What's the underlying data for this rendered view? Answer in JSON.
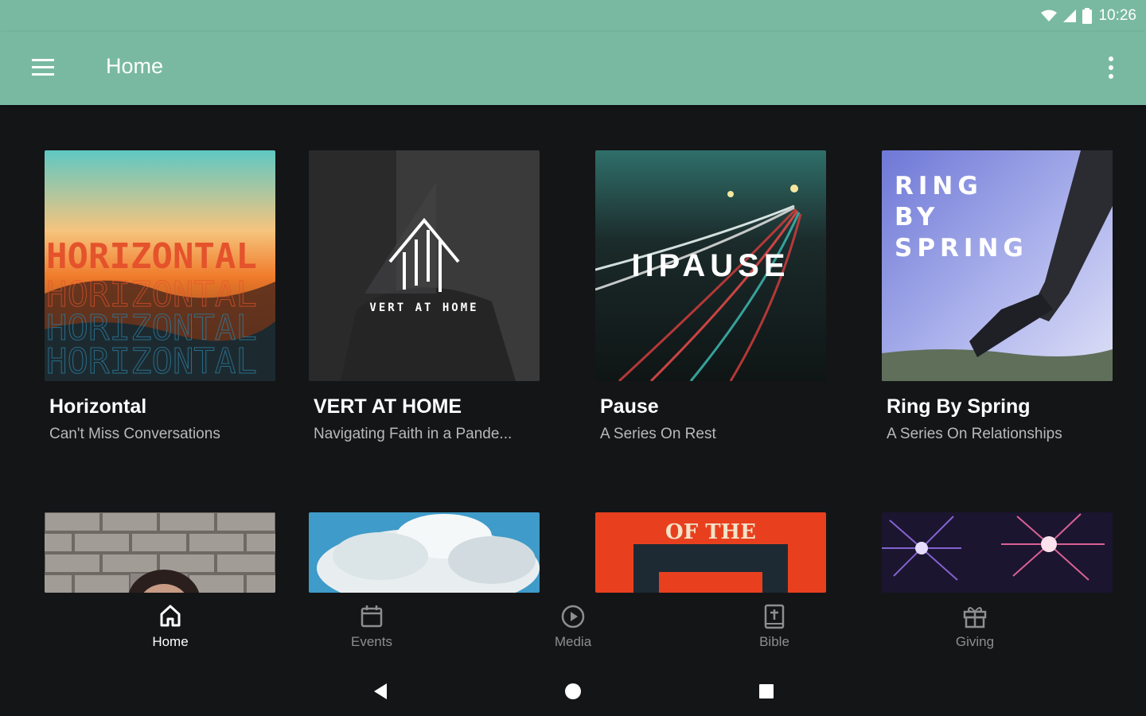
{
  "status_bar": {
    "time": "10:26"
  },
  "app_bar": {
    "title": "Home"
  },
  "cards": [
    {
      "title": "Horizontal",
      "subtitle": "Can't Miss Conversations",
      "art_text": "HORIZONTAL"
    },
    {
      "title": "VERT AT HOME",
      "subtitle": "Navigating Faith in a Pande...",
      "art_text": "VERT AT HOME"
    },
    {
      "title": "Pause",
      "subtitle": "A Series On Rest",
      "art_text": "IIPAUSE"
    },
    {
      "title": "Ring By Spring",
      "subtitle": "A Series On Relationships",
      "art_text": [
        "RING",
        "BY",
        "SPRING"
      ]
    }
  ],
  "second_row": [
    {
      "art": "brick-wall-portrait"
    },
    {
      "art": "clouds-sky"
    },
    {
      "art": "orange-poster",
      "art_text": "OF THE"
    },
    {
      "art": "fireworks"
    }
  ],
  "bottom_nav": [
    {
      "label": "Home",
      "icon": "home-icon",
      "active": true
    },
    {
      "label": "Events",
      "icon": "calendar-icon",
      "active": false
    },
    {
      "label": "Media",
      "icon": "play-circle-icon",
      "active": false
    },
    {
      "label": "Bible",
      "icon": "bible-icon",
      "active": false
    },
    {
      "label": "Giving",
      "icon": "gift-icon",
      "active": false
    }
  ],
  "colors": {
    "accent": "#79b9a2",
    "background": "#141517",
    "active_nav": "#ffffff",
    "inactive_nav": "#8e8e8e"
  }
}
